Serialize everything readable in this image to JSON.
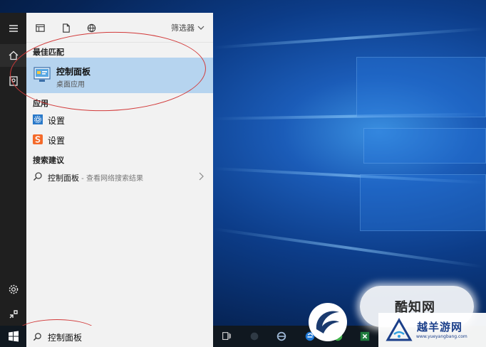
{
  "toolbar": {
    "filter_label": "筛选器",
    "icons": [
      "document-grid-icon",
      "file-icon",
      "globe-icon"
    ]
  },
  "sections": {
    "best_match": "最佳匹配",
    "apps": "应用",
    "search_suggestions": "搜索建议"
  },
  "best_match": {
    "title": "控制面板",
    "subtitle": "桌面应用",
    "icon": "control-panel-icon"
  },
  "apps": [
    {
      "label": "设置",
      "icon": "settings-gear-icon"
    },
    {
      "label": "设置",
      "icon": "sogou-settings-icon"
    }
  ],
  "suggestion": {
    "term": "控制面板",
    "hint": " - 查看网络搜索结果"
  },
  "search": {
    "query": "控制面板"
  },
  "rail": {
    "icons": [
      "menu-icon",
      "home-icon",
      "notebook-icon",
      "gear-icon",
      "feedback-icon"
    ]
  },
  "watermarks": {
    "badge_text": "酷知网",
    "site_name": "越羊游网",
    "site_url": "www.yueyangbang.com"
  },
  "colors": {
    "panel_bg": "#f2f2f2",
    "highlight": "#b6d4ef",
    "rail_bg": "#1f1f1f",
    "annotation": "#d23a3a",
    "taskbar": "#101820"
  }
}
